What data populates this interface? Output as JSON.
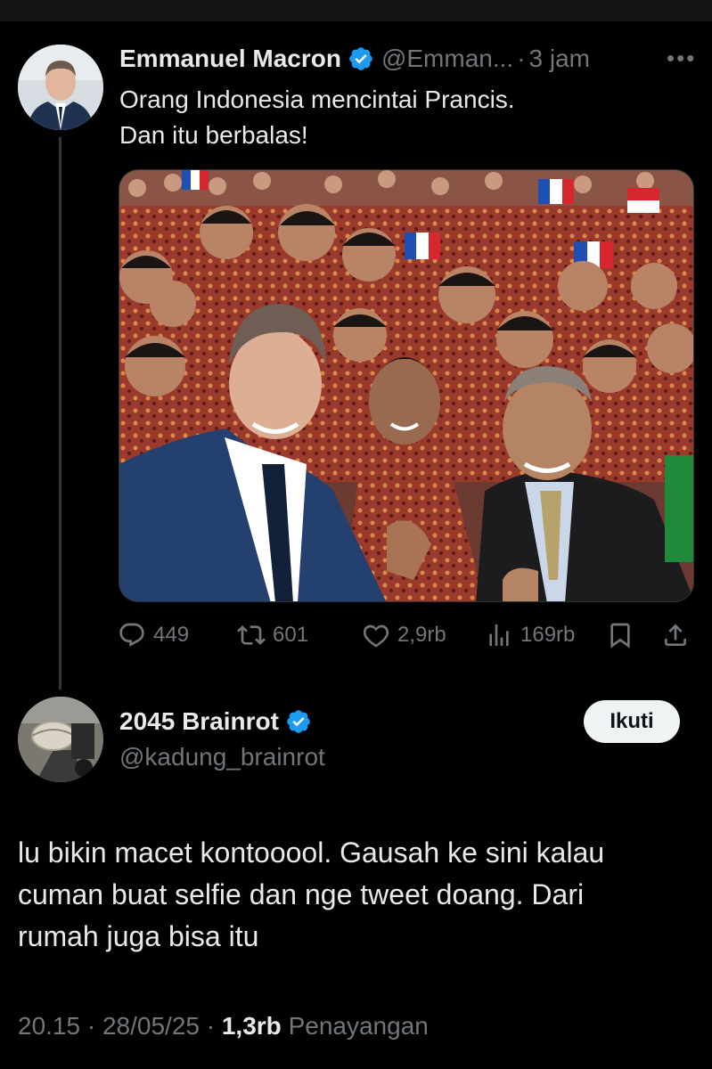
{
  "parent": {
    "author_name": "Emmanuel Macron",
    "handle": "@Emman...",
    "separator": "·",
    "time": "3 jam",
    "text_lines": [
      "Orang Indonesia mencintai Prancis.",
      "Dan itu berbalas!"
    ],
    "actions": {
      "replies": "449",
      "reposts": "601",
      "likes": "2,9rb",
      "views": "169rb"
    }
  },
  "reply": {
    "author_name": "2045 Brainrot",
    "handle": "@kadung_brainrot",
    "follow_label": "Ikuti",
    "text_lines": [
      "lu bikin macet kontooool. Gausah ke sini kalau",
      "cuman buat selfie dan nge tweet doang. Dari",
      "rumah juga bisa itu"
    ],
    "time": "20.15",
    "date": "28/05/25",
    "views_count": "1,3rb",
    "views_label": "Penayangan"
  },
  "colors": {
    "background": "#000000",
    "text_primary": "#e7e9ea",
    "text_secondary": "#71767b",
    "verified_badge": "#1d9bf0",
    "follow_button_bg": "#eff3f4"
  },
  "icons": {
    "verified": "verified-badge-icon",
    "more": "more-dots-icon",
    "reply": "reply-bubble-icon",
    "repost": "repost-icon",
    "like": "heart-icon",
    "views": "views-bars-icon",
    "bookmark": "bookmark-icon",
    "share": "share-icon"
  }
}
